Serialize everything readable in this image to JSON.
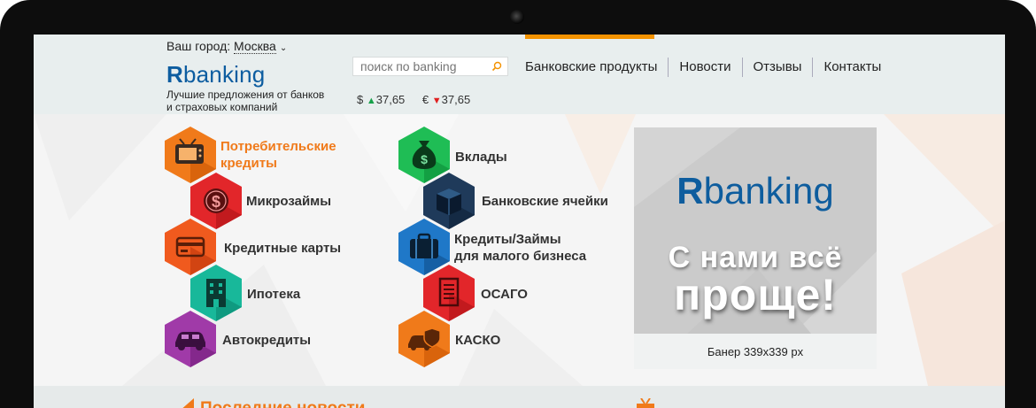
{
  "header": {
    "city_label": "Ваш город:",
    "city_value": "Москва",
    "logo_bold": "R",
    "logo_rest": "banking",
    "tagline_line1": "Лучшие предложения от банков",
    "tagline_line2": "и страховых компаний",
    "search_placeholder": "поиск по banking",
    "rates": [
      {
        "currency": "$",
        "direction": "up",
        "value": "37,65"
      },
      {
        "currency": "€",
        "direction": "down",
        "value": "37,65"
      }
    ],
    "nav": [
      "Банковские продукты",
      "Новости",
      "Отзывы",
      "Контакты"
    ]
  },
  "products": {
    "left": [
      {
        "label_line1": "Потребительские",
        "label_line2": "кредиты",
        "icon": "tv-icon",
        "color": "#f07a1a",
        "active": true
      },
      {
        "label_line1": "Микрозаймы",
        "label_line2": "",
        "icon": "dollar-coin-icon",
        "color": "#e2262a"
      },
      {
        "label_line1": "Кредитные карты",
        "label_line2": "",
        "icon": "credit-card-icon",
        "color": "#f05a1e"
      },
      {
        "label_line1": "Ипотека",
        "label_line2": "",
        "icon": "building-icon",
        "color": "#18b89a"
      },
      {
        "label_line1": "Автокредиты",
        "label_line2": "",
        "icon": "car-icon",
        "color": "#a03aa8"
      }
    ],
    "right": [
      {
        "label_line1": "Вклады",
        "label_line2": "",
        "icon": "money-bag-icon",
        "color": "#1fbd55"
      },
      {
        "label_line1": "Банковские ячейки",
        "label_line2": "",
        "icon": "safe-box-icon",
        "color": "#1f3a5a"
      },
      {
        "label_line1": "Кредиты/Займы",
        "label_line2": "для малого бизнеса",
        "icon": "briefcase-icon",
        "color": "#1f78c8"
      },
      {
        "label_line1": "ОСАГО",
        "label_line2": "",
        "icon": "document-icon",
        "color": "#e2262a"
      },
      {
        "label_line1": "КАСКО",
        "label_line2": "",
        "icon": "car-shield-icon",
        "color": "#f07a1a"
      }
    ]
  },
  "banner": {
    "logo_bold": "R",
    "logo_rest": "banking",
    "line1": "С нами всё",
    "line2": "проще!",
    "caption": "Банер 339х339 px"
  },
  "bottom": {
    "news_title": "Последние новости"
  },
  "colors": {
    "accent": "#f39200",
    "brand_blue": "#0d5da0"
  }
}
